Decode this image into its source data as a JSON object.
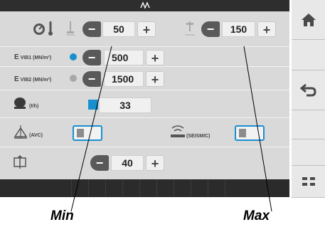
{
  "rows": {
    "limits": {
      "min_value": "50",
      "max_value": "150"
    },
    "vib1": {
      "label_prefix": "E",
      "label_sub": "VIB1 (MN/m²)",
      "value": "500"
    },
    "vib2": {
      "label_prefix": "E",
      "label_sub": "VIB2 (MN/m²)",
      "value": "1500"
    },
    "speed": {
      "unit": "(t/h)",
      "value": "33"
    },
    "avc": {
      "label": "(AVC)"
    },
    "seismic": {
      "label": "(SEISMIC)"
    },
    "bottom_value": {
      "value": "40"
    }
  },
  "annotations": {
    "min": "Min",
    "max": "Max"
  },
  "colors": {
    "accent": "#1a8fd0",
    "button_dark": "#595959",
    "bar": "#2b2b2b",
    "panel": "#d9d9d9"
  },
  "icons": [
    "speedometer-icon",
    "temperature-icon",
    "plate-min-icon",
    "plate-max-icon",
    "drum-icon",
    "avc-icon",
    "seismic-icon",
    "compaction-icon",
    "home-icon",
    "back-icon",
    "menu-icon",
    "top-logo-icon"
  ]
}
